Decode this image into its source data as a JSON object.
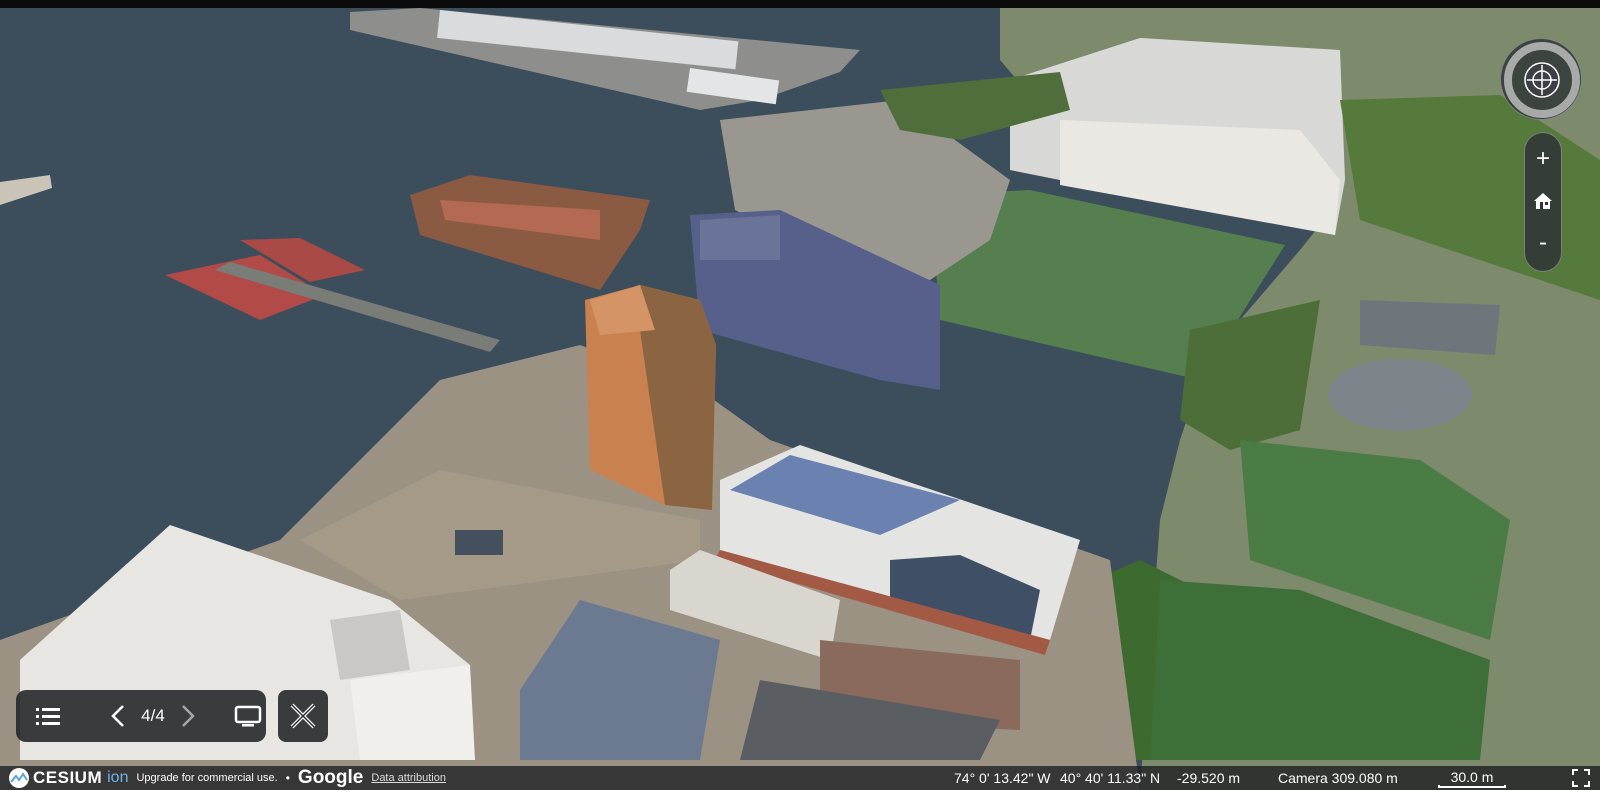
{
  "map": {
    "style": "3D photorealistic aerial view",
    "water_color": "#3c4d5b"
  },
  "navigation": {
    "zoom_in_label": "+",
    "zoom_out_label": "-",
    "compass_icon": "compass-navigation-icon",
    "home_icon": "home-icon"
  },
  "toolbar": {
    "list_icon": "list-icon",
    "prev_icon": "chevron-left-icon",
    "slide_counter": "4/4",
    "next_icon": "chevron-right-icon",
    "screen_icon": "monitor-icon",
    "close_icon": "close-x-icon"
  },
  "status": {
    "cesium_brand": "CESIUM",
    "ion_brand": "ion",
    "upgrade_text": "Upgrade for commercial use.",
    "separator": "•",
    "google_brand": "Google",
    "data_attribution": "Data attribution",
    "longitude": "74° 0' 13.42\" W",
    "latitude": "40° 40' 11.33\" N",
    "elevation": "-29.520 m",
    "camera": "Camera 309.080 m",
    "scale": "30.0 m"
  },
  "colors": {
    "ui_panel": "#26282b",
    "accent_ion": "#6fb2e8"
  }
}
